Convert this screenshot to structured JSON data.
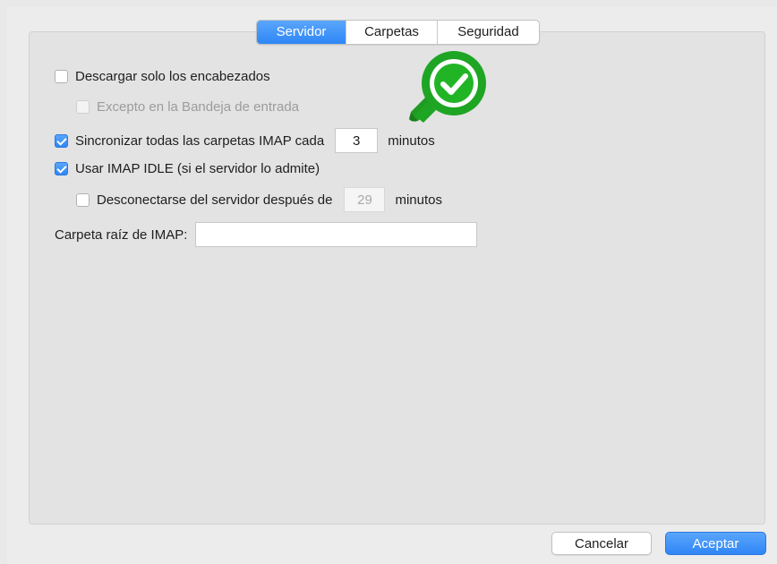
{
  "tabs": [
    {
      "label": "Servidor",
      "active": true
    },
    {
      "label": "Carpetas",
      "active": false
    },
    {
      "label": "Seguridad",
      "active": false
    }
  ],
  "options": {
    "headers_only": {
      "label": "Descargar solo los encabezados",
      "checked": false
    },
    "except_inbox": {
      "label": "Excepto en la Bandeja de entrada",
      "checked": false,
      "enabled": false
    },
    "sync_all": {
      "label": "Sincronizar todas las carpetas IMAP cada",
      "checked": true,
      "value": "3",
      "unit": "minutos"
    },
    "imap_idle": {
      "label": "Usar IMAP IDLE (si el servidor lo admite)",
      "checked": true
    },
    "disconnect": {
      "label": "Desconectarse del servidor después de",
      "checked": false,
      "value": "29",
      "unit": "minutos"
    }
  },
  "imap_root": {
    "label": "Carpeta raíz de IMAP:",
    "value": ""
  },
  "buttons": {
    "cancel": "Cancelar",
    "accept": "Aceptar"
  },
  "badge": {
    "icon": "green-checkmark-badge",
    "color": "#21a524"
  },
  "colors": {
    "accent": "#2f86f6",
    "panel": "#e3e3e3"
  }
}
